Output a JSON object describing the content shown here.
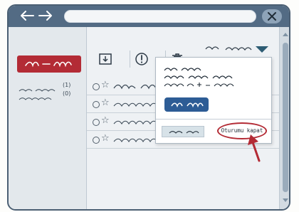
{
  "browser": {
    "back_icon": "arrow-left-icon",
    "forward_icon": "arrow-right-icon",
    "close_icon": "x-icon"
  },
  "sidebar": {
    "new_button_color": "#b32b35",
    "folders": [
      {
        "count": "(1)"
      },
      {
        "count": "(0)"
      }
    ]
  },
  "toolbar": {
    "icons": [
      "download-icon",
      "alert-icon",
      "trash-icon"
    ]
  },
  "menu": {
    "close_session_label": "Oturumu kapat",
    "highlight_color": "#2d5c95"
  },
  "colors": {
    "titlebar": "#536b84",
    "accent_red": "#b32b35",
    "window_bg": "#e6ebef"
  }
}
